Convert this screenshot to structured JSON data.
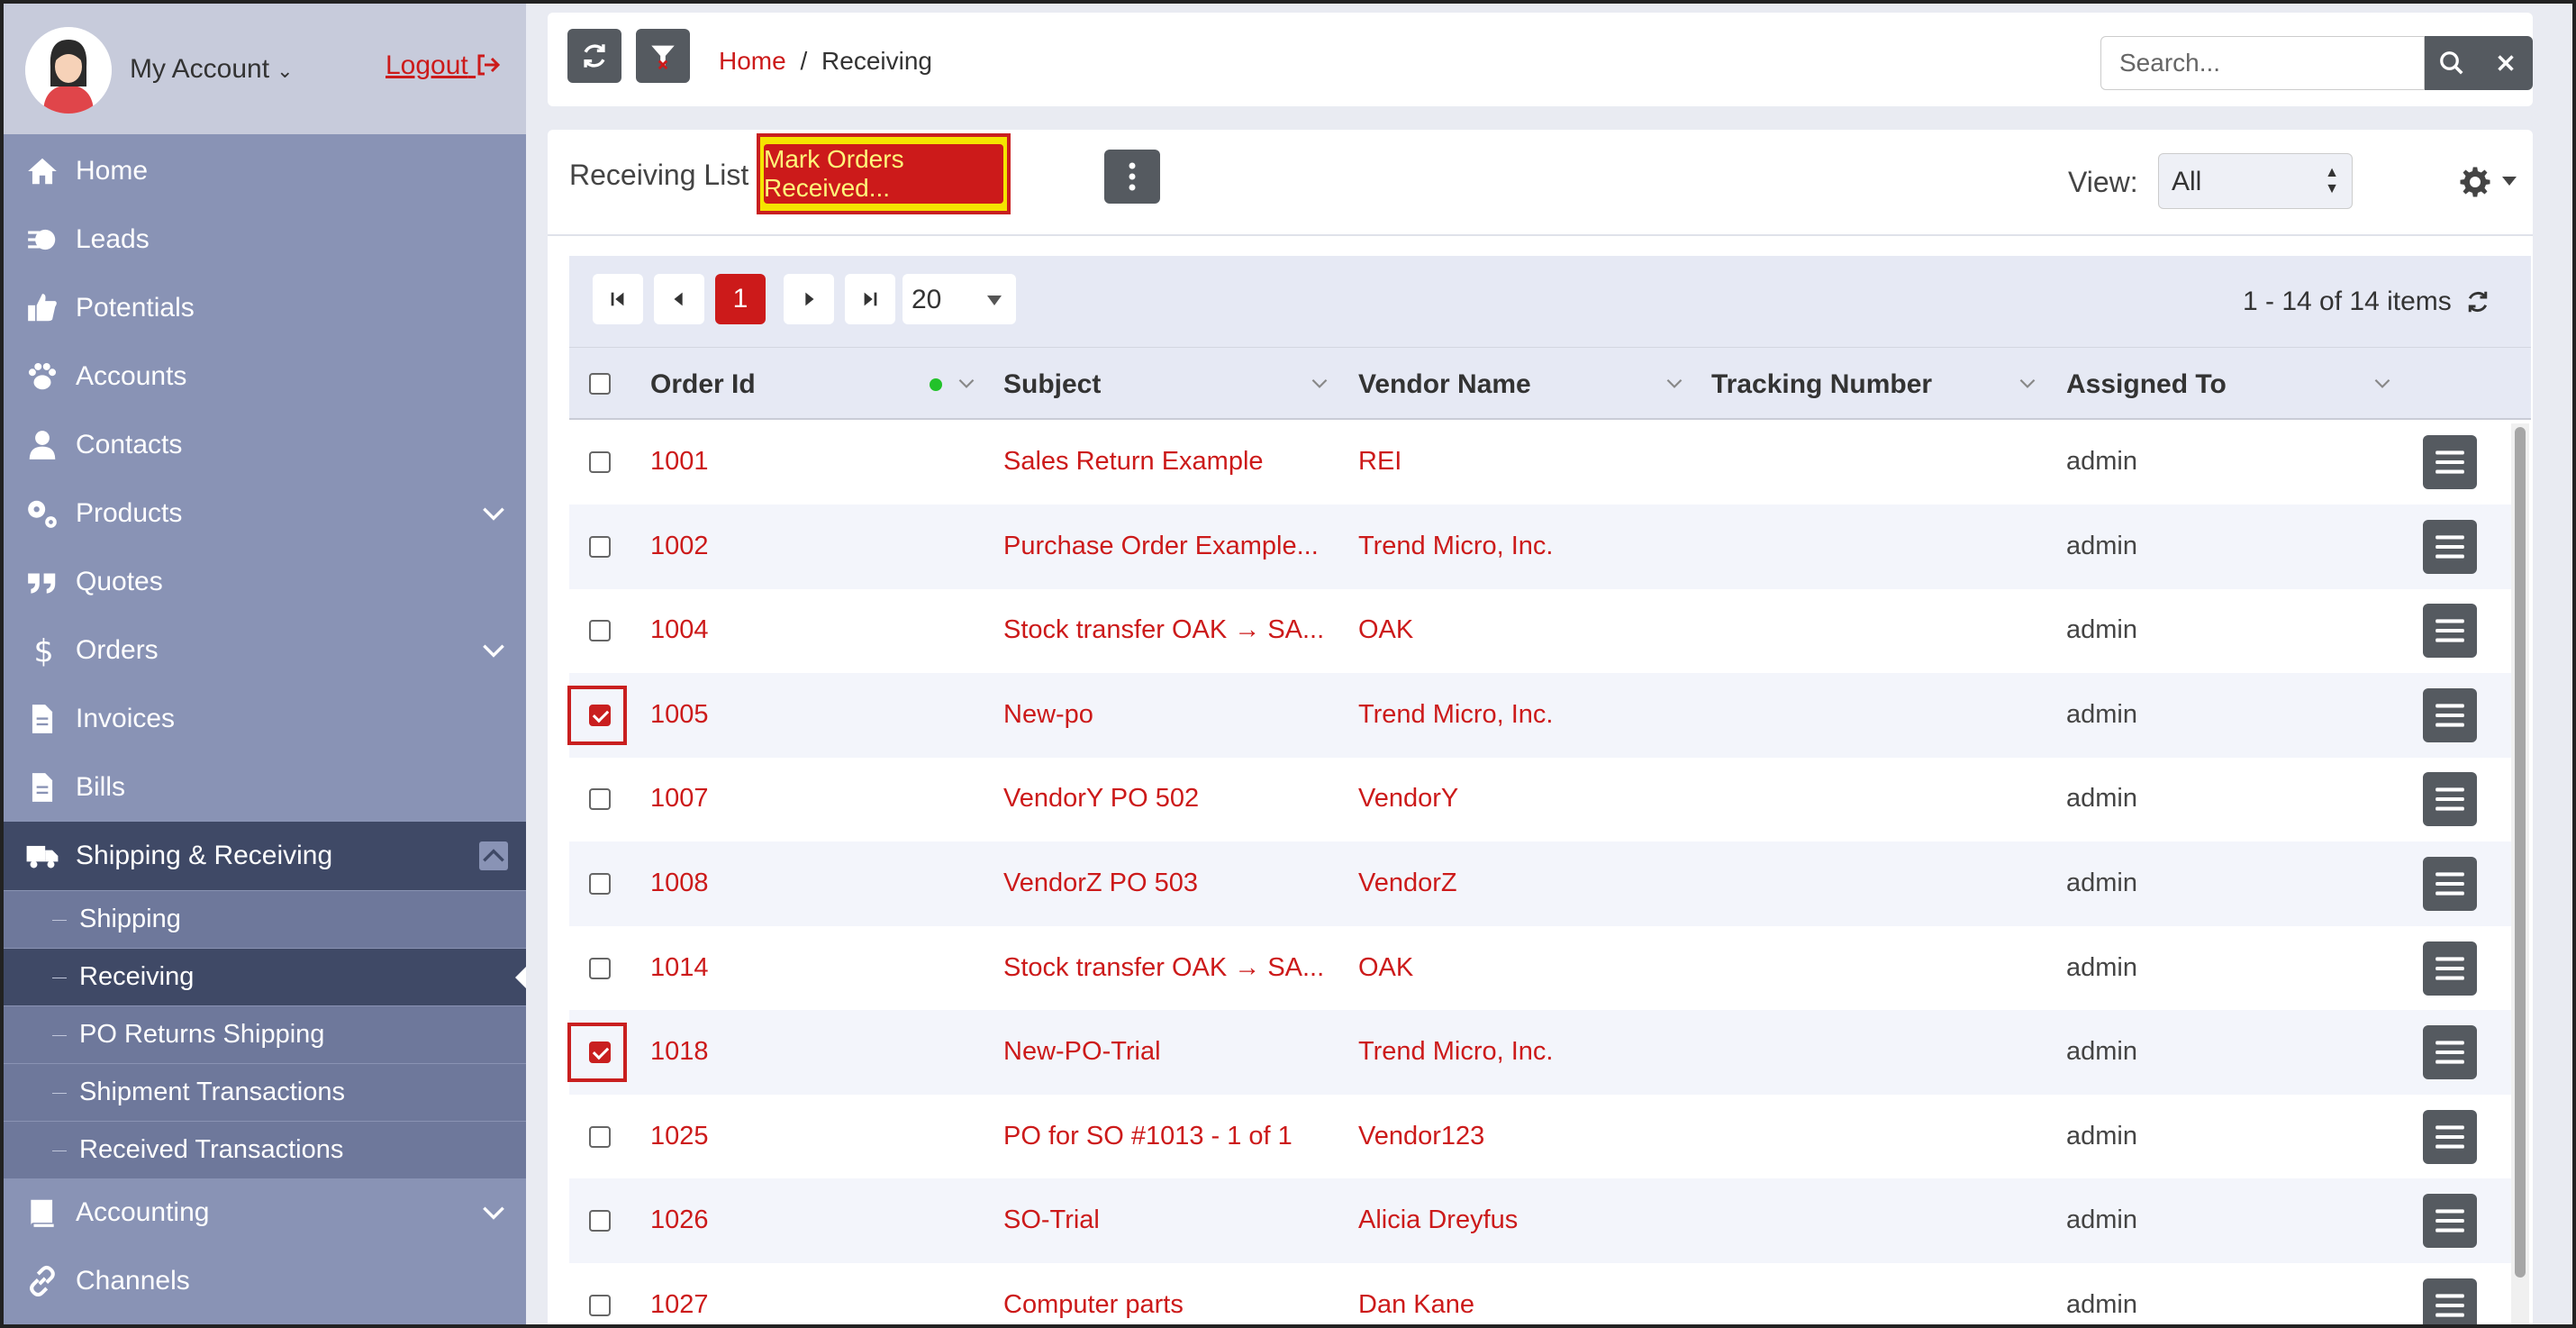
{
  "account": {
    "name": "My Account",
    "logout": "Logout"
  },
  "nav": [
    {
      "label": "Home",
      "icon": "home-icon"
    },
    {
      "label": "Leads",
      "icon": "leads-icon"
    },
    {
      "label": "Potentials",
      "icon": "thumbs-up-icon"
    },
    {
      "label": "Accounts",
      "icon": "paw-icon"
    },
    {
      "label": "Contacts",
      "icon": "user-icon"
    },
    {
      "label": "Products",
      "icon": "gears-icon",
      "expandable": true
    },
    {
      "label": "Quotes",
      "icon": "quote-icon"
    },
    {
      "label": "Orders",
      "icon": "dollar-icon",
      "expandable": true
    },
    {
      "label": "Invoices",
      "icon": "file-icon"
    },
    {
      "label": "Bills",
      "icon": "file-icon"
    },
    {
      "label": "Shipping & Receiving",
      "icon": "truck-icon",
      "expanded": true
    },
    {
      "label": "Accounting",
      "icon": "book-icon",
      "expandable": true
    },
    {
      "label": "Channels",
      "icon": "link-icon"
    }
  ],
  "subnav": [
    "Shipping",
    "Receiving",
    "PO Returns Shipping",
    "Shipment Transactions",
    "Received Transactions"
  ],
  "breadcrumb": {
    "home": "Home",
    "sep": "/",
    "current": "Receiving"
  },
  "search": {
    "placeholder": "Search..."
  },
  "list": {
    "title": "Receiving List",
    "mark_button": "Mark Orders Received...",
    "view_label": "View:",
    "view_value": "All"
  },
  "pager": {
    "current_page": "1",
    "page_size": "20",
    "summary": "1 - 14 of 14 items"
  },
  "columns": [
    "Order Id",
    "Subject",
    "Vendor Name",
    "Tracking Number",
    "Assigned To"
  ],
  "rows": [
    {
      "id": "1001",
      "subject": "Sales Return Example",
      "vendor": "REI",
      "tracking": "",
      "assigned": "admin",
      "checked": false
    },
    {
      "id": "1002",
      "subject": "Purchase Order Example...",
      "vendor": "Trend Micro, Inc.",
      "tracking": "",
      "assigned": "admin",
      "checked": false
    },
    {
      "id": "1004",
      "subject": "Stock transfer OAK → SA...",
      "vendor": "OAK",
      "tracking": "",
      "assigned": "admin",
      "checked": false
    },
    {
      "id": "1005",
      "subject": "New-po",
      "vendor": "Trend Micro, Inc.",
      "tracking": "",
      "assigned": "admin",
      "checked": true
    },
    {
      "id": "1007",
      "subject": "VendorY PO 502",
      "vendor": "VendorY",
      "tracking": "",
      "assigned": "admin",
      "checked": false
    },
    {
      "id": "1008",
      "subject": "VendorZ PO 503",
      "vendor": "VendorZ",
      "tracking": "",
      "assigned": "admin",
      "checked": false
    },
    {
      "id": "1014",
      "subject": "Stock transfer OAK → SA...",
      "vendor": "OAK",
      "tracking": "",
      "assigned": "admin",
      "checked": false
    },
    {
      "id": "1018",
      "subject": "New-PO-Trial",
      "vendor": "Trend Micro, Inc.",
      "tracking": "",
      "assigned": "admin",
      "checked": true
    },
    {
      "id": "1025",
      "subject": "PO for SO #1013 - 1 of 1",
      "vendor": "Vendor123",
      "tracking": "",
      "assigned": "admin",
      "checked": false
    },
    {
      "id": "1026",
      "subject": "SO-Trial",
      "vendor": "Alicia Dreyfus",
      "tracking": "",
      "assigned": "admin",
      "checked": false
    },
    {
      "id": "1027",
      "subject": "Computer parts",
      "vendor": "Dan Kane",
      "tracking": "",
      "assigned": "admin",
      "checked": false
    }
  ],
  "colors": {
    "accent": "#cc1a1a",
    "sidebar": "#8993b5",
    "sidebar_active": "#3f4966",
    "highlight": "#f5e400"
  }
}
